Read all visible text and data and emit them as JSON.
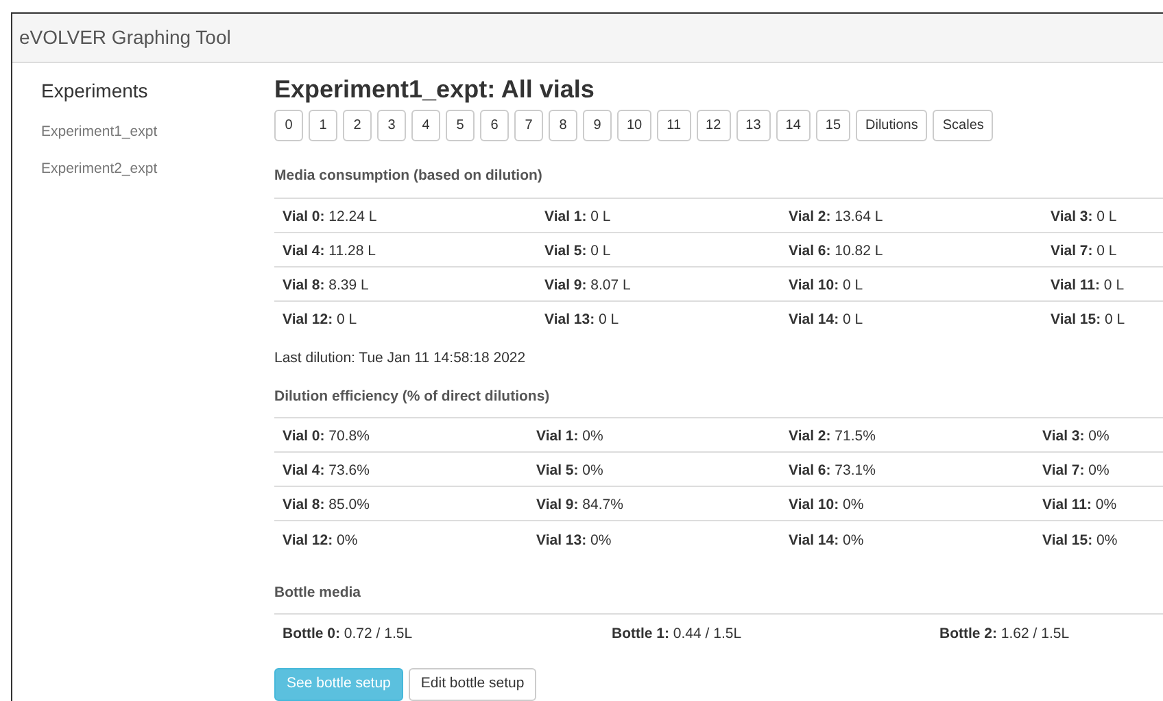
{
  "window": {
    "title": "eVOLVER Graphing Tool"
  },
  "sidebar": {
    "title": "Experiments",
    "items": [
      {
        "label": "Experiment1_expt"
      },
      {
        "label": "Experiment2_expt"
      }
    ]
  },
  "main": {
    "title": "Experiment1_expt: All vials",
    "vial_buttons": [
      "0",
      "1",
      "2",
      "3",
      "4",
      "5",
      "6",
      "7",
      "8",
      "9",
      "10",
      "11",
      "12",
      "13",
      "14",
      "15",
      "Dilutions",
      "Scales"
    ],
    "media_consumption": {
      "heading": "Media consumption (based on dilution)",
      "rows": [
        [
          "**Vial 0:** 12.24 L",
          "**Vial 1:** 0 L",
          "**Vial 2:** 13.64 L",
          "**Vial 3:** 0 L"
        ],
        [
          "**Vial 4:** 11.28 L",
          "**Vial 5:** 0 L",
          "**Vial 6:** 10.82 L",
          "**Vial 7:** 0 L"
        ],
        [
          "**Vial 8:** 8.39 L",
          "**Vial 9:** 8.07 L",
          "**Vial 10:** 0 L",
          "**Vial 11:** 0 L"
        ],
        [
          "**Vial 12:** 0 L",
          "**Vial 13:** 0 L",
          "**Vial 14:** 0 L",
          "**Vial 15:** 0 L"
        ]
      ]
    },
    "last_dilution": "Last dilution: Tue Jan 11 14:58:18 2022",
    "dilution_efficiency": {
      "heading": "Dilution efficiency (% of direct dilutions)",
      "rows": [
        [
          "**Vial 0:** 70.8%",
          "**Vial 1:** 0%",
          "**Vial 2:** 71.5%",
          "**Vial 3:** 0%"
        ],
        [
          "**Vial 4:** 73.6%",
          "**Vial 5:** 0%",
          "**Vial 6:** 73.1%",
          "**Vial 7:** 0%"
        ],
        [
          "**Vial 8:** 85.0%",
          "**Vial 9:** 84.7%",
          "**Vial 10:** 0%",
          "**Vial 11:** 0%"
        ],
        [
          "**Vial 12:** 0%",
          "**Vial 13:** 0%",
          "**Vial 14:** 0%",
          "**Vial 15:** 0%"
        ]
      ]
    },
    "bottle_media": {
      "heading": "Bottle media",
      "rows": [
        [
          "**Bottle 0:** 0.72 / 1.5L",
          "**Bottle 1:** 0.44 / 1.5L",
          "**Bottle 2:** 1.62 / 1.5L"
        ]
      ]
    },
    "actions": [
      {
        "label": "See bottle setup",
        "kind": "primary"
      },
      {
        "label": "Edit bottle setup",
        "kind": "default"
      }
    ]
  }
}
